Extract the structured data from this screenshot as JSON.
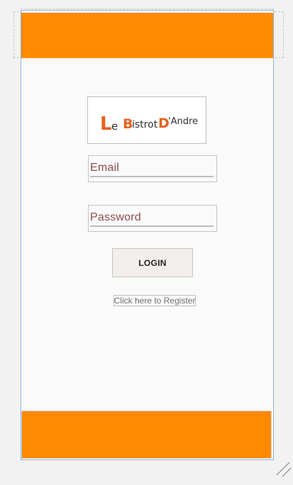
{
  "logo": {
    "part1_L": "L",
    "part1_rest": "e",
    "part2_B": "B",
    "part2_rest": "istrot",
    "part3_D": "D",
    "part3_rest": "'Andre"
  },
  "form": {
    "email_hint": "Email",
    "password_hint": "Password",
    "login_label": "LOGIN",
    "register_label": "Click here to Register"
  },
  "colors": {
    "accent": "#ff8a00",
    "logo_letter": "#e8601c",
    "hint_text": "#8b4a4a"
  },
  "icons": {
    "resize_handle": "resize-handle-icon"
  }
}
